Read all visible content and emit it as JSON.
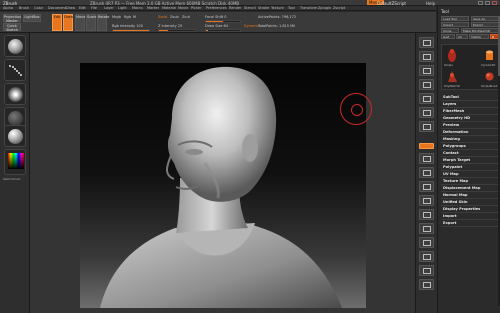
{
  "titlebar": {
    "app": "ZBrush",
    "title": "ZBrush 4R7 P3 — Free Mem 3.0 GB  Active Mem 600MB  Scratch Disk 40MB",
    "menus_label": "Menus",
    "default_script": "DefaultZScript",
    "help": "Help"
  },
  "menubar": {
    "items": [
      "Alpha",
      "Brush",
      "Color",
      "Document",
      "Draw",
      "Edit",
      "File",
      "Layer",
      "Light",
      "Macro",
      "Marker",
      "Material",
      "Movie",
      "Picker",
      "Preferences",
      "Render",
      "Stencil",
      "Stroke",
      "Texture",
      "Tool",
      "Transform",
      "Zplugin",
      "Zscript"
    ]
  },
  "toolshelf": {
    "projection_master": "Projection Master",
    "lightbox": "LightBox",
    "quick_sketch": "Quick Sketch",
    "edit": "Edit",
    "draw": "Draw",
    "move": "Move",
    "scale": "Scale",
    "rotate": "Rotate",
    "mrgb": "Mrgb",
    "rgb": "Rgb",
    "m": "M",
    "zadd": "Zadd",
    "zsub": "Zsub",
    "zcut": "Zcut",
    "rgb_intensity_label": "Rgb Intensity 100",
    "z_intensity_label": "Z Intensity 25",
    "focal_shift_label": "Focal Shift 0",
    "draw_size_label": "Draw Size 64",
    "dynamic": "Dynamic",
    "active_points": "ActivePoints: 796,172",
    "total_points": "TotalPoints: 1.815 Mil",
    "rgb_intensity_fill": 1.0,
    "z_intensity_fill": 0.25,
    "focal_shift_fill": 0.5,
    "draw_size_fill": 0.06
  },
  "leftshelf": {
    "switch_color_label": "SwitchColor"
  },
  "tray": {
    "title": "Tool",
    "rows": [
      [
        "Load Tool",
        "Save As"
      ],
      [
        "Import",
        "Export"
      ],
      [
        "Clone",
        "Make PolyMesh3D"
      ],
      [
        "GoZ",
        "All",
        "Visible",
        "R"
      ]
    ],
    "thumb_labels": [
      "Simple",
      "Cylinder3D",
      "PolyMesh3D",
      "SimpleBrush"
    ],
    "items": [
      "SubTool",
      "Layers",
      "FiberMesh",
      "Geometry HD",
      "Preview",
      "Deformation",
      "Masking",
      "Polygroups",
      "Contact",
      "Morph Target",
      "Polypaint",
      "UV Map",
      "Texture Map",
      "Displacement Map",
      "Normal Map",
      "Unified Skin",
      "Display Properties",
      "Import",
      "Export"
    ]
  },
  "colors": {
    "accent": "#e8761e",
    "brush_ring": "#c82a2a"
  }
}
